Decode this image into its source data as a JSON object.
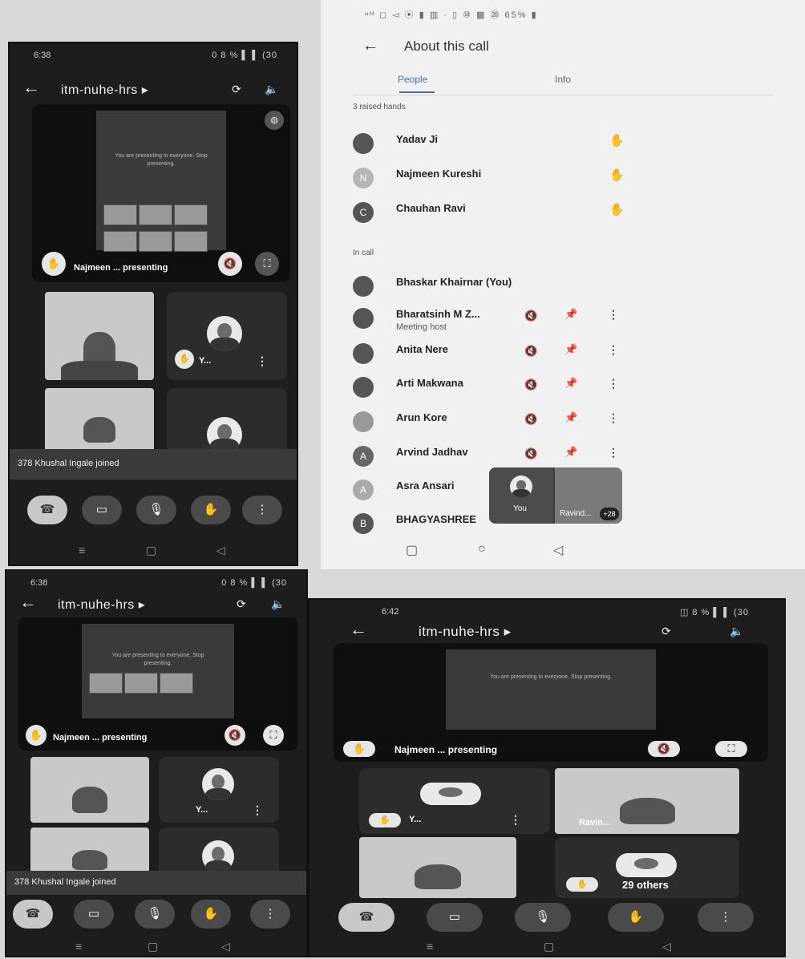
{
  "top_left_phone": {
    "status_time": "6:38",
    "status_icons": "0 8 % ▌ ▌ (30",
    "meeting_code": "itm-nuhe-hrs ▸",
    "presenter_label": "Najmeen ... presenting",
    "slide_text": "You are presenting to everyone. Stop presenting.",
    "participant_short": "Y...",
    "toast": "378 Khushal Ingale joined"
  },
  "right_panel": {
    "status_bar": "ᵸᴴ ◻ ◅ ⦿ ▮ ▥ · ▯ ⑩ ▩ ⑳ 65% ▮",
    "title": "About this call",
    "tabs": [
      "People",
      "Info"
    ],
    "raised_header": "3 raised hands",
    "raised": [
      {
        "name": "Yadav Ji",
        "initial": ""
      },
      {
        "name": "Najmeen Kureshi",
        "initial": "N"
      },
      {
        "name": "Chauhan Ravi",
        "initial": "C"
      }
    ],
    "incall_header": "In call",
    "incall": [
      {
        "name": "Bhaskar Khairnar (You)",
        "sub": "",
        "initial": ""
      },
      {
        "name": "Bharatsinh M Z...",
        "sub": "Meeting host",
        "initial": ""
      },
      {
        "name": "Anita Nere",
        "sub": "",
        "initial": ""
      },
      {
        "name": "Arti Makwana",
        "sub": "",
        "initial": ""
      },
      {
        "name": "Arun Kore",
        "sub": "",
        "initial": ""
      },
      {
        "name": "Arvind Jadhav",
        "sub": "",
        "initial": "A"
      },
      {
        "name": "Asra Ansari",
        "sub": "",
        "initial": "A"
      },
      {
        "name": "BHAGYASHREE",
        "sub": "",
        "initial": "B"
      }
    ],
    "pip_you": "You",
    "pip_other": "Ravind...",
    "pip_badge": "+28"
  },
  "bottom_left_phone": {
    "status_time": "6:38",
    "status_icons": "0 8 % ▌ ▌ (30",
    "meeting_code": "itm-nuhe-hrs ▸",
    "presenter_label": "Najmeen ... presenting",
    "slide_text": "You are presenting to everyone. Stop presenting.",
    "participant_short": "Y...",
    "toast": "378 Khushal Ingale joined"
  },
  "bottom_right_phone": {
    "status_time": "6:42",
    "status_icons": "◫ 8 % ▌ ▌ (30",
    "meeting_code": "itm-nuhe-hrs ▸",
    "presenter_label": "Najmeen ... presenting",
    "slide_text": "You are presenting to everyone. Stop presenting.",
    "participant_short": "Y...",
    "participant_ravin": "Ravin...",
    "others": "29 others"
  }
}
